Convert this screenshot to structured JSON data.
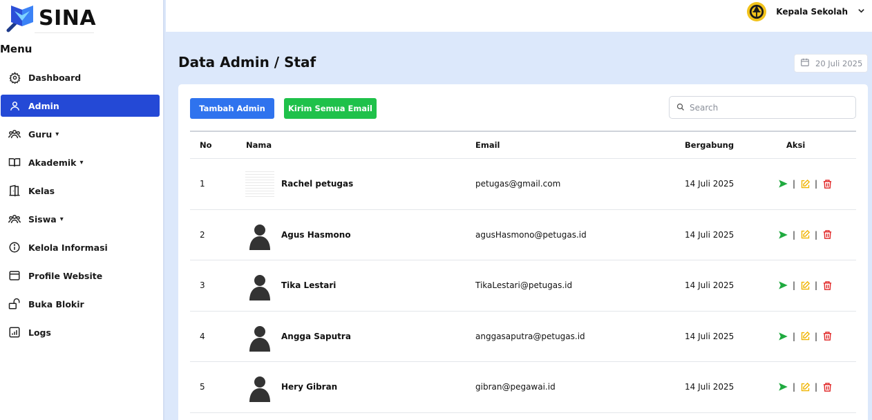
{
  "brand": {
    "name": "SINA"
  },
  "sidebar": {
    "menu_title": "Menu",
    "items": [
      {
        "label": "Dashboard",
        "icon": "gear-icon",
        "active": false,
        "has_dropdown": false
      },
      {
        "label": "Admin",
        "icon": "user-icon",
        "active": true,
        "has_dropdown": false
      },
      {
        "label": "Guru",
        "icon": "users-icon",
        "active": false,
        "has_dropdown": true
      },
      {
        "label": "Akademik",
        "icon": "book-icon",
        "active": false,
        "has_dropdown": true
      },
      {
        "label": "Kelas",
        "icon": "door-icon",
        "active": false,
        "has_dropdown": false
      },
      {
        "label": "Siswa",
        "icon": "users-icon",
        "active": false,
        "has_dropdown": true
      },
      {
        "label": "Kelola Informasi",
        "icon": "info-icon",
        "active": false,
        "has_dropdown": false
      },
      {
        "label": "Profile Website",
        "icon": "browser-icon",
        "active": false,
        "has_dropdown": false
      },
      {
        "label": "Buka Blokir",
        "icon": "unlock-icon",
        "active": false,
        "has_dropdown": false
      },
      {
        "label": "Logs",
        "icon": "chart-icon",
        "active": false,
        "has_dropdown": false
      }
    ]
  },
  "topbar": {
    "user_name": "Kepala Sekolah",
    "chevron": "⌄"
  },
  "page": {
    "title": "Data Admin / Staf",
    "date": "20 Juli 2025"
  },
  "toolbar": {
    "add_label": "Tambah Admin",
    "mail_all_label": "Kirim Semua Email",
    "search_placeholder": "Search",
    "search_value": ""
  },
  "table": {
    "headers": {
      "no": "No",
      "name": "Nama",
      "email": "Email",
      "joined": "Bergabung",
      "actions": "Aksi"
    },
    "rows": [
      {
        "no": "1",
        "name": "Rachel petugas",
        "email": "petugas@gmail.com",
        "joined": "14 Juli 2025",
        "avatar": "photo"
      },
      {
        "no": "2",
        "name": "Agus Hasmono",
        "email": "agusHasmono@petugas.id",
        "joined": "14 Juli 2025",
        "avatar": "silhouette"
      },
      {
        "no": "3",
        "name": "Tika Lestari",
        "email": "TikaLestari@petugas.id",
        "joined": "14 Juli 2025",
        "avatar": "silhouette"
      },
      {
        "no": "4",
        "name": "Angga Saputra",
        "email": "anggasaputra@petugas.id",
        "joined": "14 Juli 2025",
        "avatar": "silhouette"
      },
      {
        "no": "5",
        "name": "Hery Gibran",
        "email": "gibran@pegawai.id",
        "joined": "14 Juli 2025",
        "avatar": "silhouette"
      }
    ],
    "action_separator": "|",
    "action_icons": [
      "send-icon",
      "edit-icon",
      "trash-icon"
    ]
  },
  "colors": {
    "primary": "#2449d6",
    "add_button": "#2f73ee",
    "mail_button": "#1fc14a",
    "send": "#1faa3f",
    "edit": "#f0b400",
    "delete": "#e02424",
    "background": "#dce8fb"
  }
}
